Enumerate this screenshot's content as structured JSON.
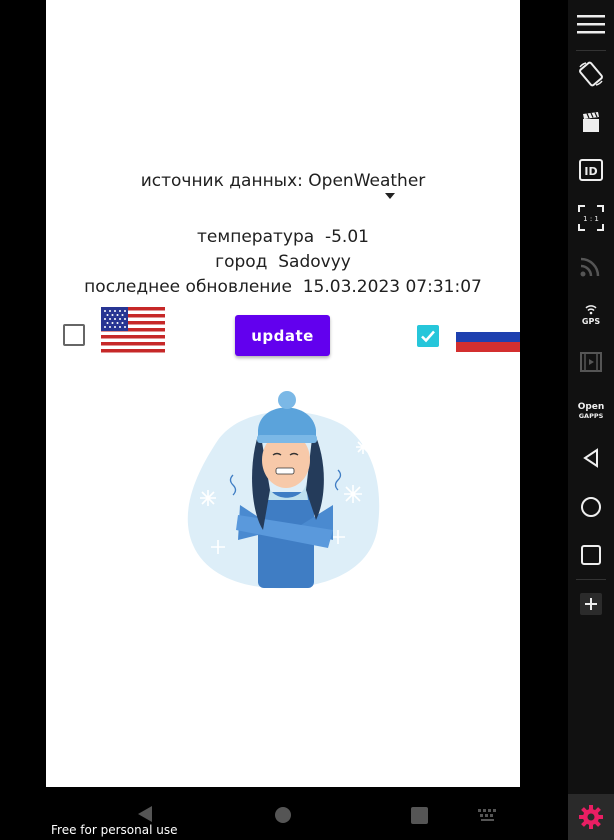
{
  "app": {
    "source_label": "источник данных: OpenWeather",
    "temperature_label": "температура",
    "temperature_value": "-5.01",
    "city_label": "город",
    "city_value": "Sadovyy",
    "updated_label": "последнее обновление",
    "updated_value": "15.03.2023 07:31:07",
    "update_button": "update",
    "checkbox_us_checked": false,
    "checkbox_ru_checked": true
  },
  "colors": {
    "accent": "#6200EE",
    "checkbox_checked": "#26C6DA"
  },
  "side_panel": {
    "icons": [
      "menu-icon",
      "rotate-icon",
      "screen-record-icon",
      "device-id-icon",
      "pixel-perfect-icon",
      "cast-icon",
      "gps-icon",
      "media-icon",
      "open-gapps-icon",
      "back-icon",
      "home-icon",
      "recents-icon",
      "add-icon",
      "settings-icon"
    ],
    "gps_label": "GPS",
    "pixel_label": "1 : 1",
    "gapps_label_top": "Open",
    "gapps_label_bottom": "GAPPS"
  },
  "watermark": "Free for personal use"
}
